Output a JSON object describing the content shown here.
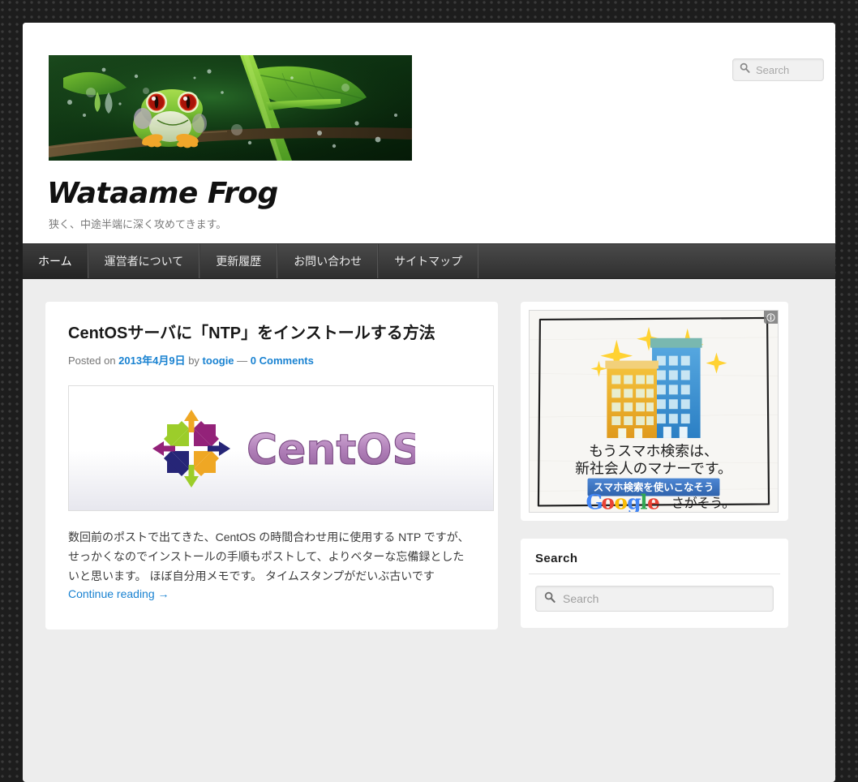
{
  "site": {
    "title": "Wataame Frog",
    "description": "狭く、中途半端に深く攻めてきます。",
    "banner_alt": "red-eyed tree frog on branch with green leaves"
  },
  "header_search": {
    "placeholder": "Search",
    "value": "",
    "icon": "search-icon"
  },
  "nav": {
    "items": [
      {
        "label": "ホーム",
        "current": true
      },
      {
        "label": "運営者について",
        "current": false
      },
      {
        "label": "更新履歴",
        "current": false
      },
      {
        "label": "お問い合わせ",
        "current": false
      },
      {
        "label": "サイトマップ",
        "current": false
      }
    ]
  },
  "post": {
    "title": "CentOSサーバに「NTP」をインストールする方法",
    "meta": {
      "posted_on_label": "Posted on",
      "date": "2013年4月9日",
      "by_label": "by",
      "author": "toogie",
      "separator": "—",
      "comments": "0 Comments"
    },
    "thumbnail_alt": "CentOS logo",
    "excerpt": "数回前のポストで出てきた、CentOS の時間合わせ用に使用する NTP ですが、せっかくなのでインストールの手順もポストして、よりベターな忘備録としたいと思います。 ほぼ自分用メモです。 タイムスタンプがだいぶ古いです",
    "continue_label": "Continue reading →"
  },
  "ad": {
    "headline_line1": "もうスマホ検索は、",
    "headline_line2": "新社会人のマナーです。",
    "button_label": "スマホ検索を使いこなそう",
    "brand": "Google",
    "brand_tagline": "さがそう。",
    "adchoices_icon": "info-icon",
    "button_color": "#3b73c4"
  },
  "search_widget": {
    "title": "Search",
    "placeholder": "Search",
    "value": "",
    "icon": "search-icon"
  },
  "colors": {
    "link": "#1982d1",
    "nav_background": "#2f2f2f",
    "page_background": "#1d1d1d",
    "main_background": "#ededed"
  }
}
